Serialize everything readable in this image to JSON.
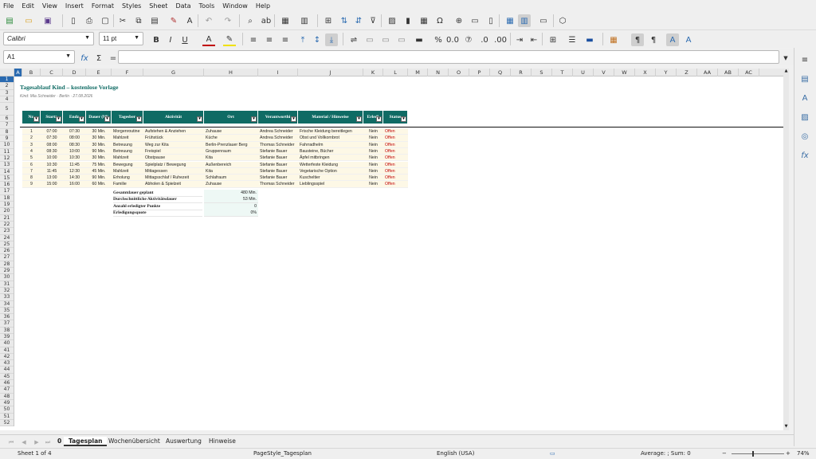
{
  "menu": [
    "File",
    "Edit",
    "View",
    "Insert",
    "Format",
    "Styles",
    "Sheet",
    "Data",
    "Tools",
    "Window",
    "Help"
  ],
  "font": {
    "name": "Calibri",
    "size": "11 pt"
  },
  "namebox": "A1",
  "formula_symbols": {
    "fx": "fx",
    "sigma": "Σ",
    "eq": "="
  },
  "columns": [
    "A",
    "B",
    "C",
    "D",
    "E",
    "F",
    "G",
    "H",
    "I",
    "J",
    "K",
    "L",
    "M",
    "N",
    "O",
    "P",
    "Q",
    "R",
    "S",
    "T",
    "U",
    "V",
    "W",
    "X",
    "Y",
    "Z",
    "AA",
    "AB",
    "AC"
  ],
  "rows": [
    "1",
    "2",
    "3",
    "4",
    "5",
    "6",
    "7",
    "8",
    "9",
    "10",
    "11",
    "12",
    "13",
    "14",
    "15",
    "16",
    "17",
    "18",
    "19",
    "20",
    "21",
    "22",
    "23",
    "24",
    "25",
    "26",
    "27",
    "28",
    "29",
    "30",
    "31",
    "32",
    "33",
    "34",
    "35",
    "36",
    "37",
    "38",
    "39",
    "40",
    "41",
    "42",
    "43",
    "44",
    "45",
    "46",
    "47",
    "48",
    "49",
    "50",
    "51",
    "52"
  ],
  "doc": {
    "title": "Tagesablauf Kind – kostenlose Vorlage",
    "subtitle": "Kind: Mia Schneider · Berlin · 27.08.2026"
  },
  "headers": [
    "Nr.",
    "Startz",
    "Endz",
    "Dauer (Mi",
    "Tagesber",
    "Aktivität",
    "Ort",
    "Verantworthi",
    "Material / Hinweise",
    "Erledi",
    "Status"
  ],
  "table": [
    [
      "1",
      "07:00",
      "07:30",
      "30 Min.",
      "Morgenroutine",
      "Aufstehen & Anziehen",
      "Zuhause",
      "Andrea Schneider",
      "Frische Kleidung bereitlegen",
      "Nein",
      "Offen"
    ],
    [
      "2",
      "07:30",
      "08:00",
      "30 Min.",
      "Mahlzeit",
      "Frühstück",
      "Küche",
      "Andrea Schneider",
      "Obst und Vollkornbrot",
      "Nein",
      "Offen"
    ],
    [
      "3",
      "08:00",
      "08:30",
      "30 Min.",
      "Betreuung",
      "Weg zur Kita",
      "Berlin-Prenzlauer Berg",
      "Thomas Schneider",
      "Fahrradhelm",
      "Nein",
      "Offen"
    ],
    [
      "4",
      "08:30",
      "10:00",
      "90 Min.",
      "Betreuung",
      "Freispiel",
      "Gruppenraum",
      "Stefanie Bauer",
      "Bausteine, Bücher",
      "Nein",
      "Offen"
    ],
    [
      "5",
      "10:00",
      "10:30",
      "30 Min.",
      "Mahlzeit",
      "Obstpause",
      "Kita",
      "Stefanie Bauer",
      "Äpfel mitbringen",
      "Nein",
      "Offen"
    ],
    [
      "6",
      "10:30",
      "11:45",
      "75 Min.",
      "Bewegung",
      "Spielplatz / Bewegung",
      "Außenbereich",
      "Stefanie Bauer",
      "Wetterfeste Kleidung",
      "Nein",
      "Offen"
    ],
    [
      "7",
      "11:45",
      "12:30",
      "45 Min.",
      "Mahlzeit",
      "Mittagessen",
      "Kita",
      "Stefanie Bauer",
      "Vegetarische Option",
      "Nein",
      "Offen"
    ],
    [
      "8",
      "13:00",
      "14:30",
      "90 Min.",
      "Erholung",
      "Mittagsschlaf / Ruhezeit",
      "Schlafraum",
      "Stefanie Bauer",
      "Kuscheltier",
      "Nein",
      "Offen"
    ],
    [
      "9",
      "15:00",
      "16:00",
      "60 Min.",
      "Familie",
      "Abholen & Spielzeit",
      "Zuhause",
      "Thomas Schneider",
      "Lieblingsspiel",
      "Nein",
      "Offen"
    ]
  ],
  "summary": [
    {
      "label": "Gesamtdauer geplant",
      "value": "480 Min."
    },
    {
      "label": "Durchschnittliche Aktivitätsdauer",
      "value": "53 Min."
    },
    {
      "label": "Anzahl erledigter Punkte",
      "value": "0"
    },
    {
      "label": "Erledigungsquote",
      "value": "0%"
    }
  ],
  "tabs": {
    "active_index": "0",
    "names": [
      "Tagesplan",
      "Wochenübersicht",
      "Auswertung",
      "Hinweise"
    ]
  },
  "status": {
    "sheet": "Sheet 1 of 4",
    "pagestyle": "PageStyle_Tagesplan",
    "lang": "English (USA)",
    "calc": "Average: ; Sum: 0",
    "zoom": "74%"
  },
  "colors": {
    "header": "#0f6b64",
    "title": "#0f6b64",
    "status_open": "#c00000",
    "row_tint": "#fdf8e6",
    "summary_tint": "#eef8f5"
  }
}
